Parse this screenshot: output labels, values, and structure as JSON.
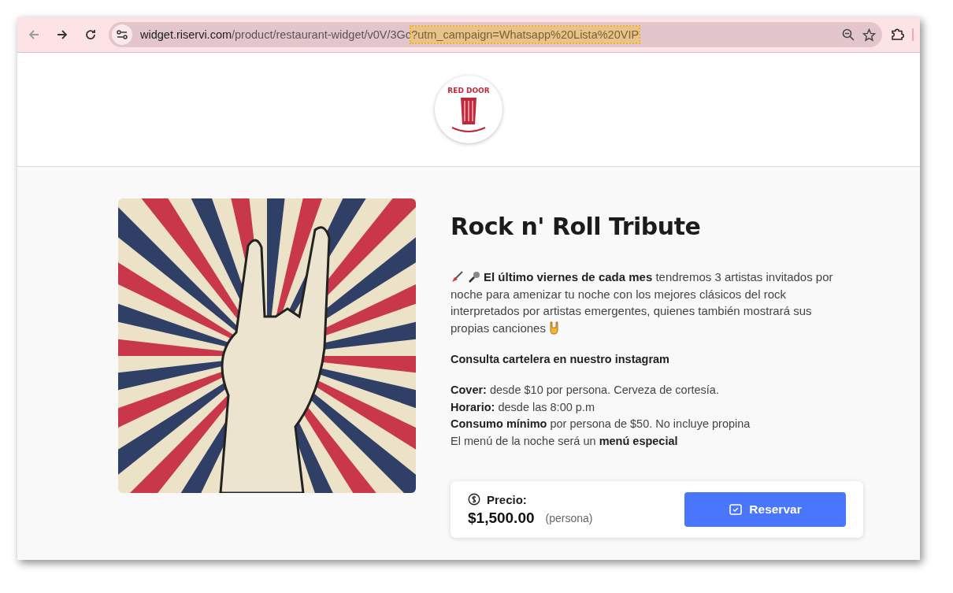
{
  "browser": {
    "url_host": "widget.riservi.com",
    "url_path": "/product/restaurant-widget/v0V/3Gc",
    "url_query": "?utm_campaign=Whatsapp%20Lista%20VIP"
  },
  "header": {
    "logo_text": "RED DOOR"
  },
  "event": {
    "title": "Rock n' Roll Tribute",
    "intro": "**El último viernes de cada mes** tendremos 3 artistas invitados por noche para amenizar tu noche con los mejores clásicos del rock interpretados por artistas emergentes, quienes también mostrará sus propias canciones",
    "instagram_note": "Consulta cartelera en nuestro instagram",
    "details": [
      "**Cover:** desde $10 por persona. Cerveza de cortesía.",
      "**Horario:** desde las 8:00 p.m",
      "**Consumo mínimo** por persona de $50. No incluye propina",
      "El menú de la noche será un **menú especial**"
    ]
  },
  "booking": {
    "price_label": "Precio:",
    "price": "$1,500.00",
    "unit": "(persona)",
    "button": "Reservar"
  }
}
